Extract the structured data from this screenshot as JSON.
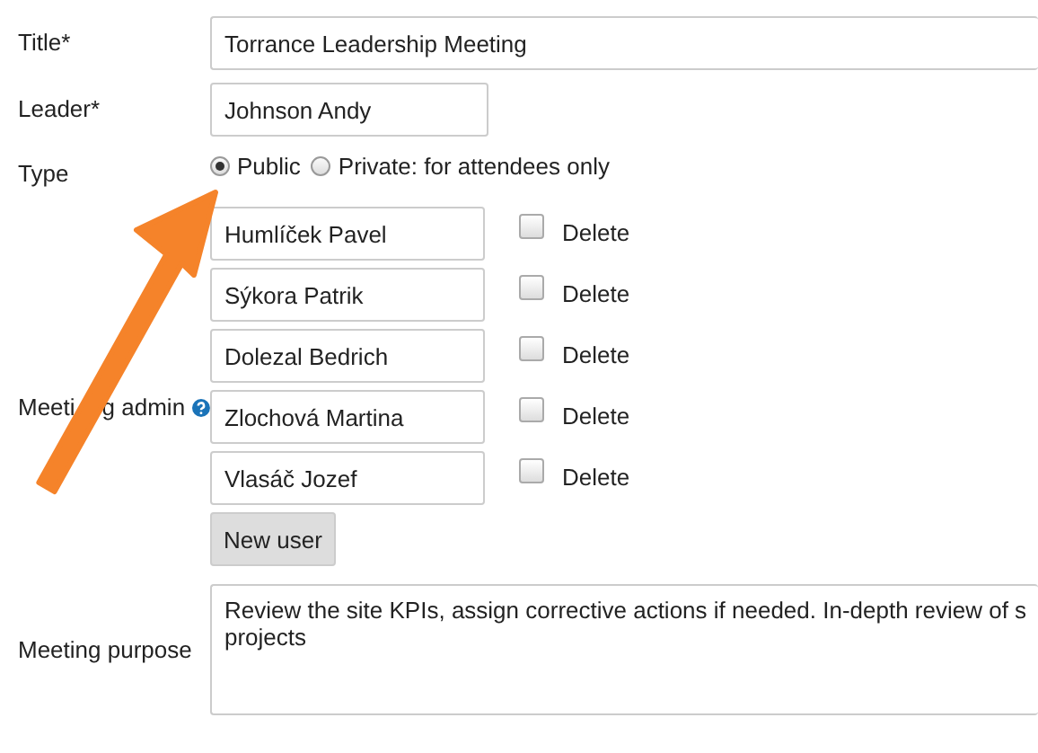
{
  "form": {
    "title": {
      "label": "Title*",
      "value": "Torrance Leadership Meeting"
    },
    "leader": {
      "label": "Leader*",
      "value": "Johnson Andy"
    },
    "type": {
      "label": "Type",
      "options": [
        {
          "label": "Public",
          "selected": true
        },
        {
          "label": "Private: for attendees only",
          "selected": false
        }
      ]
    },
    "meeting_admin": {
      "label_parts": [
        "Meeti",
        "g admin"
      ],
      "users": [
        {
          "name": "Humlíček Pavel",
          "delete_label": "Delete",
          "checked": false
        },
        {
          "name": "Sýkora Patrik",
          "delete_label": "Delete",
          "checked": false
        },
        {
          "name": "Dolezal Bedrich",
          "delete_label": "Delete",
          "checked": false
        },
        {
          "name": "Zlochová Martina",
          "delete_label": "Delete",
          "checked": false
        },
        {
          "name": "Vlasáč Jozef",
          "delete_label": "Delete",
          "checked": false
        }
      ],
      "new_user_button": "New user"
    },
    "purpose": {
      "label": "Meeting purpose",
      "lines": [
        "Review the site KPIs, assign corrective actions if needed. In-depth review of s",
        "projects"
      ]
    }
  }
}
